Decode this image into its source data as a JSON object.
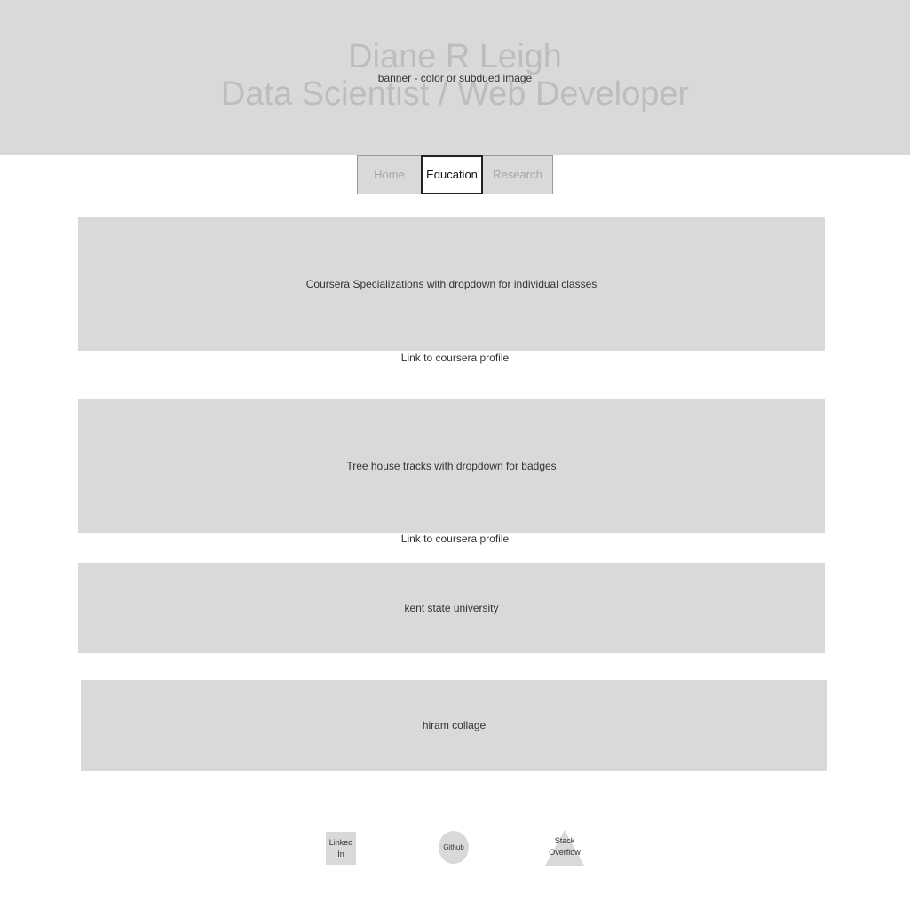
{
  "banner": {
    "name": "Diane R Leigh",
    "role": "Data Scientist / Web Developer",
    "note": "banner - color or subdued image"
  },
  "nav": {
    "tabs": [
      {
        "label": "Home",
        "active": false
      },
      {
        "label": "Education",
        "active": true
      },
      {
        "label": "Research",
        "active": false
      }
    ]
  },
  "sections": [
    {
      "label": "Coursera Specializations with dropdown for individual classes",
      "link": "Link to coursera profile"
    },
    {
      "label": "Tree house tracks with dropdown for badges",
      "link": "Link to coursera profile"
    },
    {
      "label": "kent state university"
    },
    {
      "label": "hiram collage"
    }
  ],
  "social": {
    "linkedin_line1": "Linked",
    "linkedin_line2": "In",
    "github": "Github",
    "stack_line1": "Stack",
    "stack_line2": "Overflow"
  },
  "colors": {
    "placeholder_gray": "#d9d9d9",
    "muted_text": "#a6a6a6",
    "banner_text": "#bdbdbd"
  }
}
